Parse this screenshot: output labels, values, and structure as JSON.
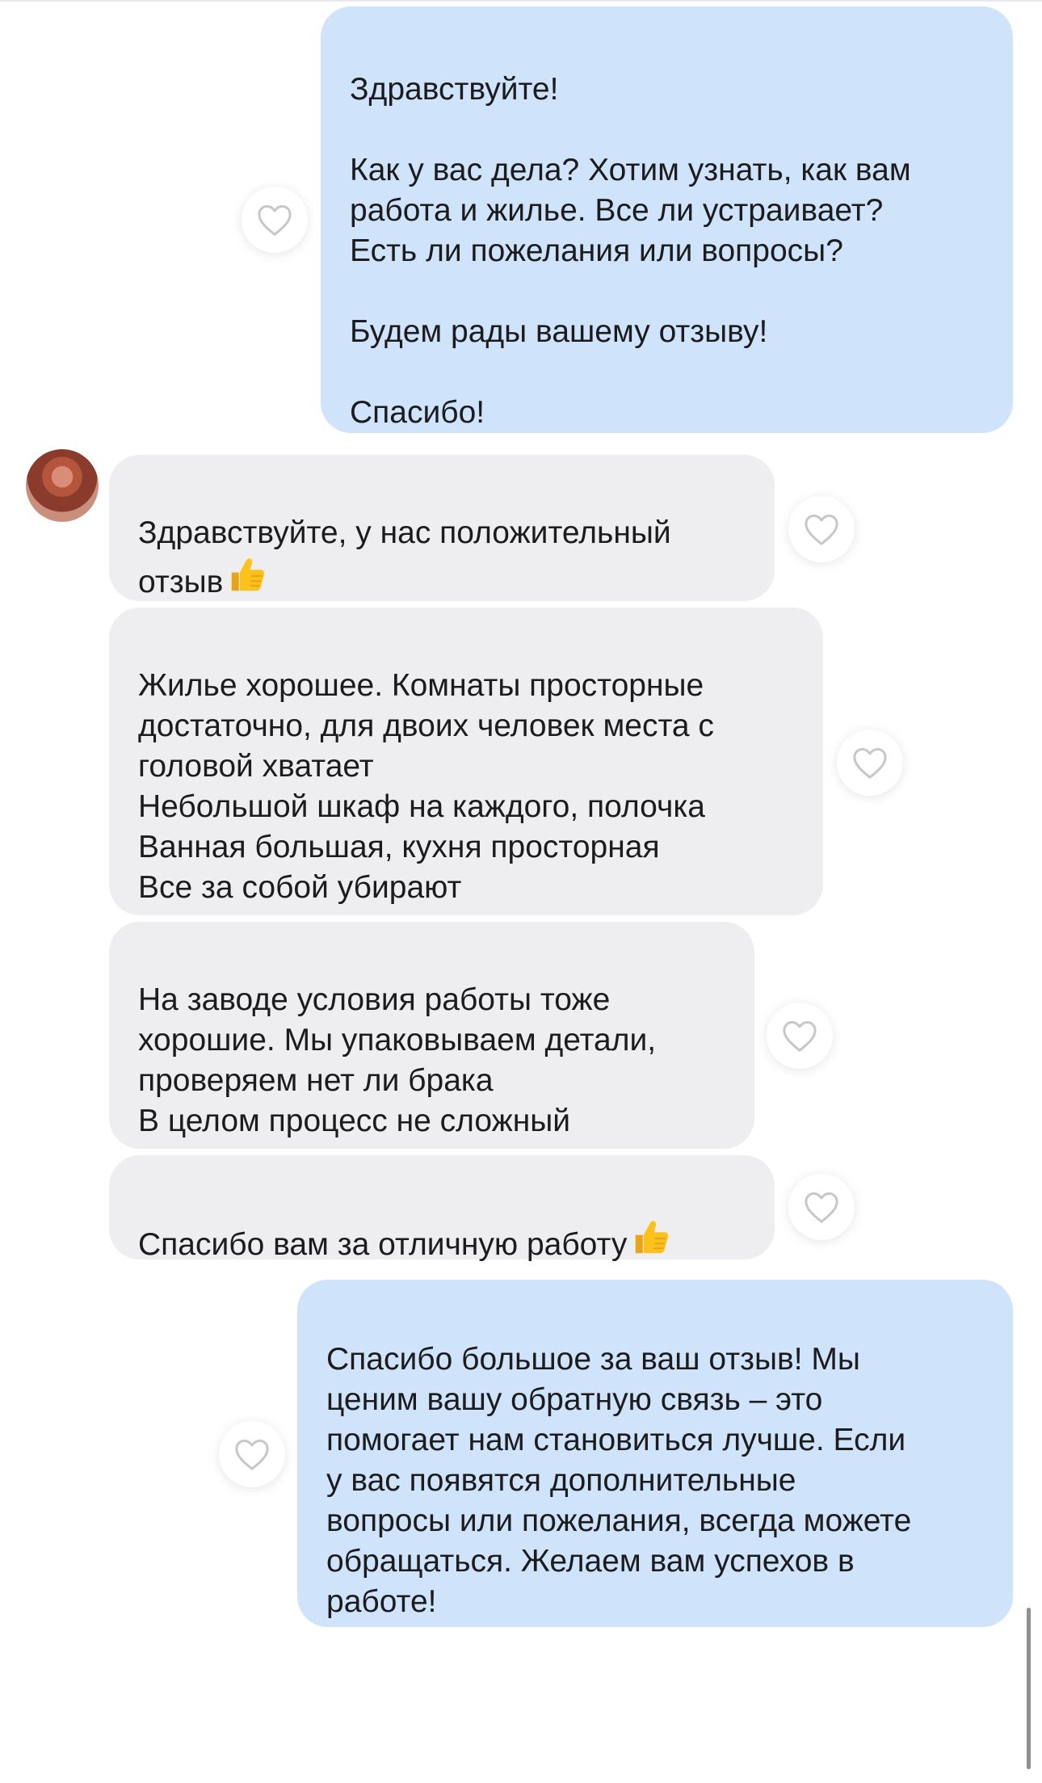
{
  "messages": [
    {
      "from": "me",
      "text": "Здравствуйте!\n\nКак у вас дела? Хотим узнать, как вам\nработа и жилье. Все ли устраивает?\nЕсть ли пожелания или вопросы?\n\nБудем рады вашему отзыву!\n\nСпасибо!"
    },
    {
      "from": "them",
      "text": "Здравствуйте, у нас положительный\nотзыв",
      "emoji": "thumbs-up"
    },
    {
      "from": "them",
      "text": "Жилье хорошее. Комнаты просторные\nдостаточно, для двоих человек места с\nголовой хватает\nНебольшой шкаф на каждого, полочка\nВанная большая, кухня просторная\nВсе за собой убирают"
    },
    {
      "from": "them",
      "text": "На заводе условия работы тоже\nхорошие. Мы упаковываем детали,\nпроверяем нет ли брака\nВ целом процесс не сложный"
    },
    {
      "from": "them",
      "text": "Спасибо вам за отличную работу",
      "emoji": "thumbs-up"
    },
    {
      "from": "me",
      "text": "Спасибо большое за ваш отзыв! Мы\nценим вашу обратную связь – это\nпомогает нам становиться лучше. Если\nу вас появятся дополнительные\nвопросы или пожелания, всегда можете\nобращаться. Желаем вам успехов в\nработе!"
    }
  ],
  "icons": {
    "reaction": "heart-outline-icon",
    "emoji": "thumbs-up-icon"
  },
  "colors": {
    "outgoing_bubble": "#cfe3fb",
    "incoming_bubble": "#eeeef0",
    "heart_stroke": "#c7c7cc"
  }
}
